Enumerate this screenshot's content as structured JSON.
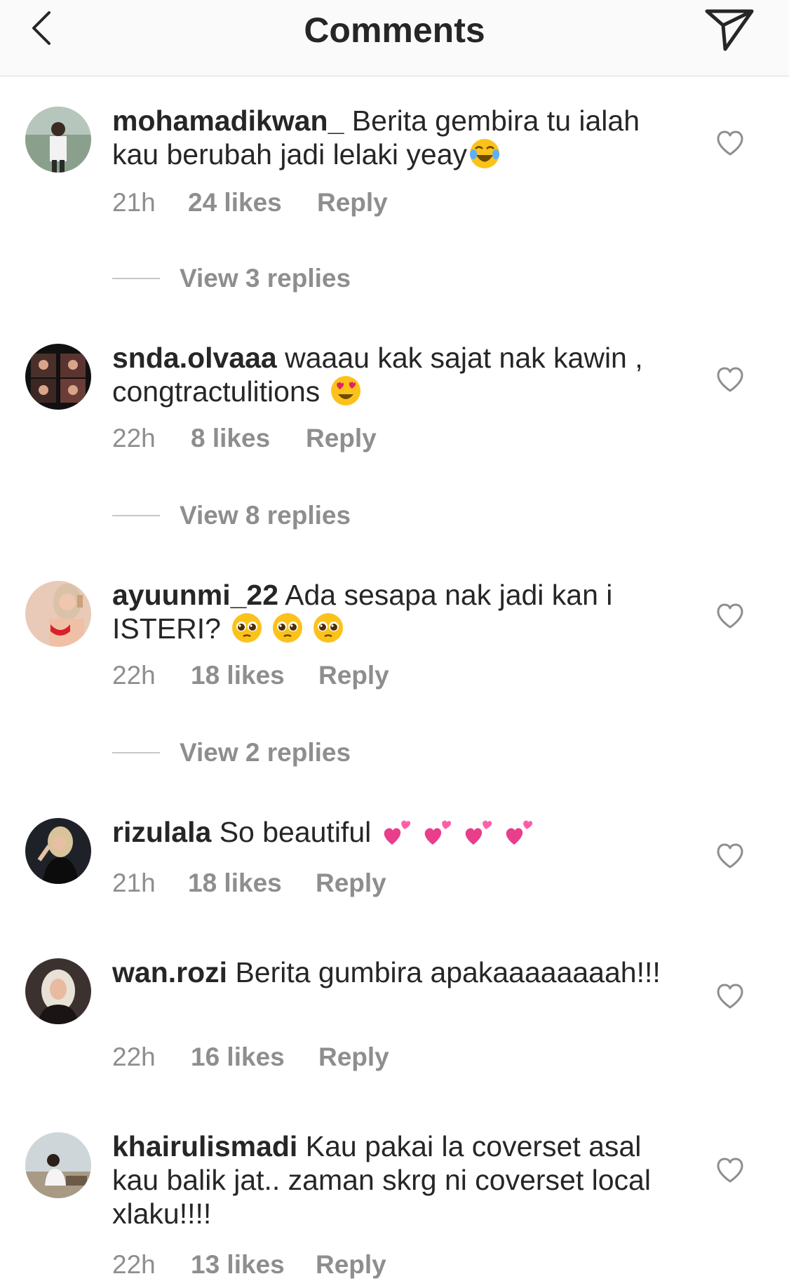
{
  "header": {
    "title": "Comments",
    "back_icon": "chevron-left-icon",
    "send_icon": "paper-plane-icon"
  },
  "comments": [
    {
      "username": "mohamadikwan_",
      "text": "Berita gembira tu ialah kau berubah jadi lelaki yeay",
      "emojis": [
        "face-with-tears-of-joy-emoji"
      ],
      "time": "21h",
      "likes": "24 likes",
      "reply": "Reply",
      "view_replies": "View 3 replies"
    },
    {
      "username": "snda.olvaaa",
      "text": "waaau kak sajat nak kawin , congtractulitions",
      "emojis": [
        "heart-eyes-emoji"
      ],
      "time": "22h",
      "likes": "8 likes",
      "reply": "Reply",
      "view_replies": "View 8 replies"
    },
    {
      "username": "ayuunmi_22",
      "text": "Ada sesapa nak jadi kan i ISTERI?",
      "emojis": [
        "pleading-face-emoji",
        "pleading-face-emoji",
        "pleading-face-emoji"
      ],
      "time": "22h",
      "likes": "18 likes",
      "reply": "Reply",
      "view_replies": "View 2 replies"
    },
    {
      "username": "rizulala",
      "text": "So beautiful",
      "emojis": [
        "two-hearts-emoji",
        "two-hearts-emoji",
        "two-hearts-emoji",
        "two-hearts-emoji"
      ],
      "time": "21h",
      "likes": "18 likes",
      "reply": "Reply"
    },
    {
      "username": "wan.rozi",
      "text": "Berita gumbira apakaaaaaaaah!!!",
      "time": "22h",
      "likes": "16 likes",
      "reply": "Reply"
    },
    {
      "username": "khairulismadi",
      "text": "Kau pakai la coverset asal kau balik jat.. zaman skrg ni coverset local xlaku!!!!",
      "time": "22h",
      "likes": "13 likes",
      "reply": "Reply"
    }
  ],
  "colors": {
    "primary_text": "#262626",
    "secondary_text": "#8e8e8e",
    "header_bg": "#fafafa",
    "divider": "#dcdcdc"
  }
}
